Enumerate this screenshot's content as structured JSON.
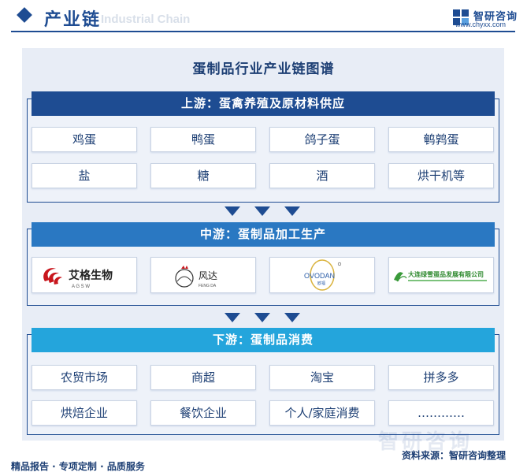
{
  "header": {
    "title": "产业链",
    "subtitle": "Industrial Chain",
    "brand_name": "智研咨询",
    "brand_url": "www.chyxx.com"
  },
  "diagram": {
    "title": "蛋制品行业产业链图谱",
    "upstream": {
      "heading": "上游：蛋禽养殖及原材料供应",
      "items": [
        "鸡蛋",
        "鸭蛋",
        "鸽子蛋",
        "鹌鹑蛋",
        "盐",
        "糖",
        "酒",
        "烘干机等"
      ]
    },
    "midstream": {
      "heading": "中游：蛋制品加工生产",
      "companies": [
        {
          "name": "艾格生物",
          "sub": "A G S W"
        },
        {
          "name": "风达",
          "sub": "FENG DA"
        },
        {
          "name": "OVODAN",
          "sub": "欧福"
        },
        {
          "name": "大连绿雪蛋品发展有限公司",
          "sub": ""
        }
      ]
    },
    "downstream": {
      "heading": "下游：蛋制品消费",
      "items": [
        "农贸市场",
        "商超",
        "淘宝",
        "拼多多",
        "烘焙企业",
        "餐饮企业",
        "个人/家庭消费",
        "…………"
      ]
    }
  },
  "footer": {
    "left": "精品报告 · 专项定制 · 品质服务",
    "source": "资料来源：智研咨询整理",
    "watermark": "智研咨询"
  },
  "colors": {
    "primary": "#1e4c92",
    "upstream_head": "#1e4c92",
    "midstream_head": "#2a78c2",
    "downstream_head": "#24a5dc",
    "panel": "#e8edf6"
  }
}
